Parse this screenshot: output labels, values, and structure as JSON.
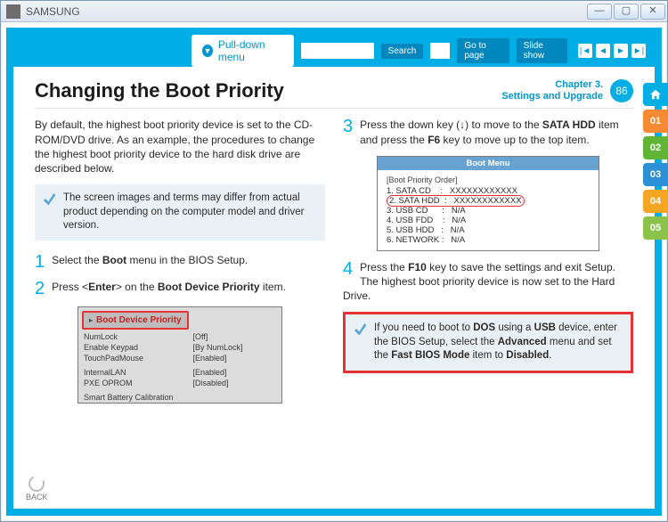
{
  "window": {
    "title": "SAMSUNG"
  },
  "toolbar": {
    "pulldown": "Pull-down menu",
    "search": "Search",
    "goto": "Go to page",
    "slideshow": "Slide show"
  },
  "tabs": {
    "c1": "01",
    "c2": "02",
    "c3": "03",
    "c4": "04",
    "c5": "05"
  },
  "header": {
    "title": "Changing the Boot Priority",
    "chapter": "Chapter 3.",
    "section": "Settings and Upgrade",
    "page": "86"
  },
  "left": {
    "intro": "By default, the highest boot priority device is set to the CD-ROM/DVD drive. As an example, the procedures to change the highest boot priority device to the hard disk drive are described below.",
    "note": "The screen images and terms may differ from actual product depending on the computer model and driver version.",
    "step1_pre": "Select the ",
    "step1_bold": "Boot",
    "step1_post": " menu in the BIOS Setup.",
    "step2_pre": "Press <",
    "step2_bold1": "Enter",
    "step2_mid": "> on the ",
    "step2_bold2": "Boot Device Priority",
    "step2_post": " item.",
    "bios": {
      "title": "Boot Device Priority",
      "rows": [
        [
          "NumLock",
          "[Off]"
        ],
        [
          "Enable Keypad",
          "[By NumLock]"
        ],
        [
          "TouchPadMouse",
          "[Enabled]"
        ],
        [
          "InternalLAN",
          "[Enabled]"
        ],
        [
          "PXE OPROM",
          "[Disabled]"
        ],
        [
          "Smart Battery Calibration",
          ""
        ]
      ]
    }
  },
  "right": {
    "step3_a": "Press the down key (↓) to move to the ",
    "step3_b": "SATA HDD",
    "step3_c": " item and press the ",
    "step3_d": "F6",
    "step3_e": " key to move up to the top item.",
    "bios": {
      "title": "Boot Menu",
      "category": "[Boot Priority Order]",
      "rows": [
        "1. SATA CD    :   XXXXXXXXXXXX",
        "2. SATA HDD  :   XXXXXXXXXXXX",
        "3. USB CD      :   N/A",
        "4. USB FDD    :   N/A",
        "5. USB HDD   :   N/A",
        "6. NETWORK :   N/A"
      ]
    },
    "step4_a": "Press the ",
    "step4_b": "F10",
    "step4_c": " key to save the settings and exit Setup.",
    "step4_line2": "The highest boot priority device is now set to the Hard Drive.",
    "note_a": "If you need to boot to ",
    "note_b": "DOS",
    "note_c": " using a ",
    "note_d": "USB",
    "note_e": " device, enter the BIOS Setup, select the ",
    "note_f": "Advanced",
    "note_g": " menu and set the ",
    "note_h": "Fast BIOS Mode",
    "note_i": " item to ",
    "note_j": "Disabled",
    "note_k": "."
  },
  "back": "BACK"
}
